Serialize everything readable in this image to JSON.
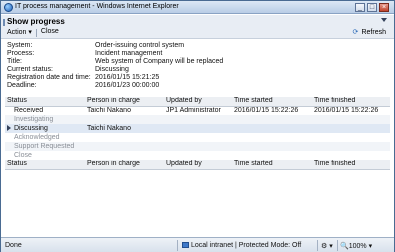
{
  "window": {
    "title": "IT process management - Windows Internet Explorer"
  },
  "header": {
    "page_title": "Show progress",
    "menu": [
      {
        "label": "Action ▾"
      },
      {
        "label": "Close"
      }
    ],
    "refresh_label": "Refresh"
  },
  "info": [
    {
      "label": "System:",
      "value": "Order-issuing control system"
    },
    {
      "label": "Process:",
      "value": "Incident management"
    },
    {
      "label": "Title:",
      "value": "Web system of Company will be replaced"
    },
    {
      "label": "Current status:",
      "value": "Discussing"
    },
    {
      "label": "Registration date and time:",
      "value": "2016/01/15 15:21:25"
    },
    {
      "label": "Deadline:",
      "value": "2016/01/23 00:00:00"
    }
  ],
  "table": {
    "headers": [
      "Status",
      "Person in charge",
      "Updated by",
      "Time started",
      "Time finished"
    ],
    "rows": [
      {
        "status": "Received",
        "person": "Taichi Nakano",
        "updated_by": "JP1 Administrator",
        "started": "2016/01/15 15:22:26",
        "finished": "2016/01/15 15:22:26",
        "style": "normal"
      },
      {
        "status": "Investigating",
        "person": "",
        "updated_by": "",
        "started": "",
        "finished": "",
        "style": "gray"
      },
      {
        "status": "Discussing",
        "person": "Taichi Nakano",
        "updated_by": "",
        "started": "",
        "finished": "",
        "style": "current"
      },
      {
        "status": "Acknowledged",
        "person": "",
        "updated_by": "",
        "started": "",
        "finished": "",
        "style": "gray"
      },
      {
        "status": "Support Requested",
        "person": "",
        "updated_by": "",
        "started": "",
        "finished": "",
        "style": "gray"
      },
      {
        "status": "Close",
        "person": "",
        "updated_by": "",
        "started": "",
        "finished": "",
        "style": "gray"
      }
    ],
    "footer": [
      "Status",
      "Person in charge",
      "Updated by",
      "Time started",
      "Time finished"
    ]
  },
  "statusbar": {
    "left": "Done",
    "zone": "Local intranet | Protected Mode: Off",
    "tools": "⚙ ▾",
    "zoom": "🔍100%  ▾"
  }
}
